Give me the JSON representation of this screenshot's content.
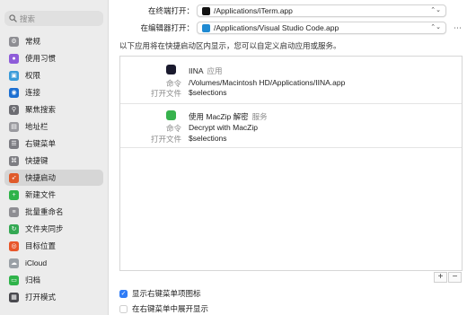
{
  "search": {
    "placeholder": "搜索"
  },
  "sidebar": {
    "items": [
      {
        "label": "常规",
        "icon": "gear-icon",
        "color": "#8e8e93",
        "glyph": "⚙"
      },
      {
        "label": "使用习惯",
        "icon": "person-icon",
        "color": "#8e5cd9",
        "glyph": "●"
      },
      {
        "label": "权限",
        "icon": "photo-icon",
        "color": "#3a9bd9",
        "glyph": "▣"
      },
      {
        "label": "连接",
        "icon": "globe-icon",
        "color": "#1c6fd1",
        "glyph": "◉"
      },
      {
        "label": "聚焦搜索",
        "icon": "magnifier-icon",
        "color": "#6d6d72",
        "glyph": "⚲"
      },
      {
        "label": "地址栏",
        "icon": "document-icon",
        "color": "#9a9a9f",
        "glyph": "▤"
      },
      {
        "label": "右键菜单",
        "icon": "menu-icon",
        "color": "#7c7c82",
        "glyph": "☰"
      },
      {
        "label": "快捷键",
        "icon": "keyboard-icon",
        "color": "#7d7d82",
        "glyph": "⌘"
      },
      {
        "label": "快捷启动",
        "icon": "rocket-icon",
        "color": "#e05a2a",
        "glyph": "➶"
      },
      {
        "label": "新建文件",
        "icon": "plus-icon",
        "color": "#2fb34a",
        "glyph": "+"
      },
      {
        "label": "批量重命名",
        "icon": "rename-icon",
        "color": "#8e8e93",
        "glyph": "≡"
      },
      {
        "label": "文件夹同步",
        "icon": "sync-icon",
        "color": "#34a853",
        "glyph": "↻"
      },
      {
        "label": "目标位置",
        "icon": "target-icon",
        "color": "#e8562a",
        "glyph": "◎"
      },
      {
        "label": "iCloud",
        "icon": "cloud-icon",
        "color": "#9aa0a6",
        "glyph": "☁"
      },
      {
        "label": "归档",
        "icon": "archive-icon",
        "color": "#2fb34a",
        "glyph": "▭"
      },
      {
        "label": "打开模式",
        "icon": "window-icon",
        "color": "#4a4a4f",
        "glyph": "▦"
      }
    ],
    "active_index": 8
  },
  "main": {
    "terminal_label": "在终端打开：",
    "terminal_value": "/Applications/iTerm.app",
    "editor_label": "在编辑器打开：",
    "editor_value": "/Applications/Visual Studio Code.app",
    "more_glyph": "⋯",
    "description": "以下应用将在快捷启动区内显示，您可以自定义启动应用或服务。",
    "entries": [
      {
        "title": "IINA",
        "kind": "应用",
        "icon": "iina-app-icon",
        "icon_color": "#1a1a2e",
        "command_label": "命令",
        "command": "/Volumes/Macintosh HD/Applications/IINA.app",
        "open_label": "打开文件",
        "open_value": "$selections"
      },
      {
        "title": "使用 MacZip 解密",
        "kind": "服务",
        "icon": "maczip-app-icon",
        "icon_color": "#37b24d",
        "command_label": "命令",
        "command": "Decrypt with MacZip",
        "open_label": "打开文件",
        "open_value": "$selections"
      }
    ],
    "add_label": "+",
    "remove_label": "−",
    "checkbox1": {
      "label": "显示右键菜单项图标",
      "checked": true
    },
    "checkbox2": {
      "label": "在右键菜单中展开显示",
      "checked": false
    }
  },
  "colors": {
    "accent": "#2f7cf6",
    "sidebar_bg": "#ececec",
    "selected_bg": "#d6d6d6"
  }
}
